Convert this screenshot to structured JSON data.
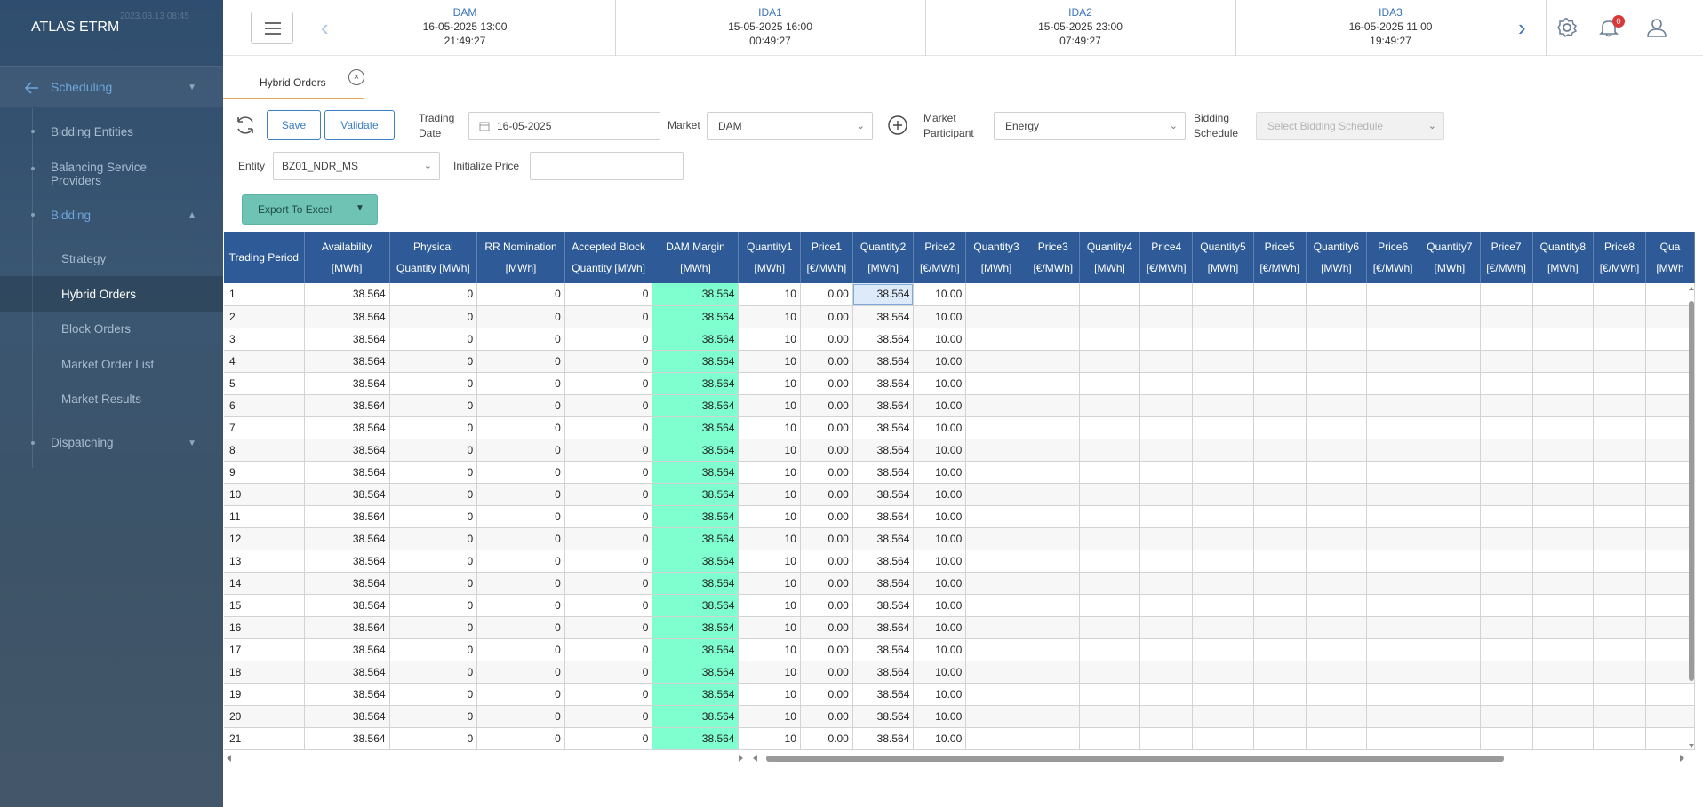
{
  "app": {
    "brand": "ATLAS ETRM",
    "brand_ghost": "2023.03.13 08:45"
  },
  "sidebar": {
    "scheduling_label": "Scheduling",
    "items": [
      "Bidding Entities",
      "Balancing Service Providers"
    ],
    "bidding_label": "Bidding",
    "bidding_items": [
      "Strategy",
      "Hybrid Orders",
      "Block Orders",
      "Market Order List",
      "Market Results"
    ],
    "dispatching_label": "Dispatching"
  },
  "markets": [
    {
      "name": "DAM",
      "date": "16-05-2025 13:00",
      "countdown": "21:49:27"
    },
    {
      "name": "IDA1",
      "date": "15-05-2025 16:00",
      "countdown": "00:49:27"
    },
    {
      "name": "IDA2",
      "date": "15-05-2025 23:00",
      "countdown": "07:49:27"
    },
    {
      "name": "IDA3",
      "date": "16-05-2025 11:00",
      "countdown": "19:49:27"
    }
  ],
  "notifications": {
    "count": "0"
  },
  "tab": {
    "label": "Hybrid Orders",
    "close": "×"
  },
  "form": {
    "save_label": "Save",
    "validate_label": "Validate",
    "trading_date_label": "Trading Date",
    "trading_date_line1": "Trading",
    "trading_date_line2": "Date",
    "trading_date_value": "16-05-2025",
    "market_label": "Market",
    "market_value": "DAM",
    "participant_line1": "Market",
    "participant_line2": "Participant",
    "participant_value": "Energy",
    "schedule_line1": "Bidding",
    "schedule_line2": "Schedule",
    "schedule_placeholder": "Select Bidding Schedule",
    "entity_label": "Entity",
    "entity_value": "BZ01_NDR_MS",
    "init_price_label": "Initialize Price",
    "init_price_value": "",
    "export_label": "Export To Excel"
  },
  "table": {
    "columns": [
      [
        "Trading Period",
        ""
      ],
      [
        "Availability",
        "[MWh]"
      ],
      [
        "Physical",
        "Quantity [MWh]"
      ],
      [
        "RR Nomination",
        "[MWh]"
      ],
      [
        "Accepted Block",
        "Quantity [MWh]"
      ],
      [
        "DAM Margin",
        "[MWh]"
      ],
      [
        "Quantity1",
        "[MWh]"
      ],
      [
        "Price1",
        "[€/MWh]"
      ],
      [
        "Quantity2",
        "[MWh]"
      ],
      [
        "Price2",
        "[€/MWh]"
      ],
      [
        "Quantity3",
        "[MWh]"
      ],
      [
        "Price3",
        "[€/MWh]"
      ],
      [
        "Quantity4",
        "[MWh]"
      ],
      [
        "Price4",
        "[€/MWh]"
      ],
      [
        "Quantity5",
        "[MWh]"
      ],
      [
        "Price5",
        "[€/MWh]"
      ],
      [
        "Quantity6",
        "[MWh]"
      ],
      [
        "Price6",
        "[€/MWh]"
      ],
      [
        "Quantity7",
        "[MWh]"
      ],
      [
        "Price7",
        "[€/MWh]"
      ],
      [
        "Quantity8",
        "[MWh]"
      ],
      [
        "Price8",
        "[€/MWh]"
      ],
      [
        "Qua",
        "[MWh"
      ]
    ],
    "rows": [
      [
        "1",
        "38.564",
        "0",
        "0",
        "0",
        "38.564",
        "10",
        "0.00",
        "38.564",
        "10.00"
      ],
      [
        "2",
        "38.564",
        "0",
        "0",
        "0",
        "38.564",
        "10",
        "0.00",
        "38.564",
        "10.00"
      ],
      [
        "3",
        "38.564",
        "0",
        "0",
        "0",
        "38.564",
        "10",
        "0.00",
        "38.564",
        "10.00"
      ],
      [
        "4",
        "38.564",
        "0",
        "0",
        "0",
        "38.564",
        "10",
        "0.00",
        "38.564",
        "10.00"
      ],
      [
        "5",
        "38.564",
        "0",
        "0",
        "0",
        "38.564",
        "10",
        "0.00",
        "38.564",
        "10.00"
      ],
      [
        "6",
        "38.564",
        "0",
        "0",
        "0",
        "38.564",
        "10",
        "0.00",
        "38.564",
        "10.00"
      ],
      [
        "7",
        "38.564",
        "0",
        "0",
        "0",
        "38.564",
        "10",
        "0.00",
        "38.564",
        "10.00"
      ],
      [
        "8",
        "38.564",
        "0",
        "0",
        "0",
        "38.564",
        "10",
        "0.00",
        "38.564",
        "10.00"
      ],
      [
        "9",
        "38.564",
        "0",
        "0",
        "0",
        "38.564",
        "10",
        "0.00",
        "38.564",
        "10.00"
      ],
      [
        "10",
        "38.564",
        "0",
        "0",
        "0",
        "38.564",
        "10",
        "0.00",
        "38.564",
        "10.00"
      ],
      [
        "11",
        "38.564",
        "0",
        "0",
        "0",
        "38.564",
        "10",
        "0.00",
        "38.564",
        "10.00"
      ],
      [
        "12",
        "38.564",
        "0",
        "0",
        "0",
        "38.564",
        "10",
        "0.00",
        "38.564",
        "10.00"
      ],
      [
        "13",
        "38.564",
        "0",
        "0",
        "0",
        "38.564",
        "10",
        "0.00",
        "38.564",
        "10.00"
      ],
      [
        "14",
        "38.564",
        "0",
        "0",
        "0",
        "38.564",
        "10",
        "0.00",
        "38.564",
        "10.00"
      ],
      [
        "15",
        "38.564",
        "0",
        "0",
        "0",
        "38.564",
        "10",
        "0.00",
        "38.564",
        "10.00"
      ],
      [
        "16",
        "38.564",
        "0",
        "0",
        "0",
        "38.564",
        "10",
        "0.00",
        "38.564",
        "10.00"
      ],
      [
        "17",
        "38.564",
        "0",
        "0",
        "0",
        "38.564",
        "10",
        "0.00",
        "38.564",
        "10.00"
      ],
      [
        "18",
        "38.564",
        "0",
        "0",
        "0",
        "38.564",
        "10",
        "0.00",
        "38.564",
        "10.00"
      ],
      [
        "19",
        "38.564",
        "0",
        "0",
        "0",
        "38.564",
        "10",
        "0.00",
        "38.564",
        "10.00"
      ],
      [
        "20",
        "38.564",
        "0",
        "0",
        "0",
        "38.564",
        "10",
        "0.00",
        "38.564",
        "10.00"
      ],
      [
        "21",
        "38.564",
        "0",
        "0",
        "0",
        "38.564",
        "10",
        "0.00",
        "38.564",
        "10.00"
      ]
    ],
    "selected_cell": {
      "row": 0,
      "col": 8
    }
  },
  "colors": {
    "header": "#2e5b97",
    "margin_fill": "#7fffd0",
    "accent": "#3b7fc4",
    "sidebar": "#2f4d6e",
    "tab_underline": "#e7a95c"
  }
}
